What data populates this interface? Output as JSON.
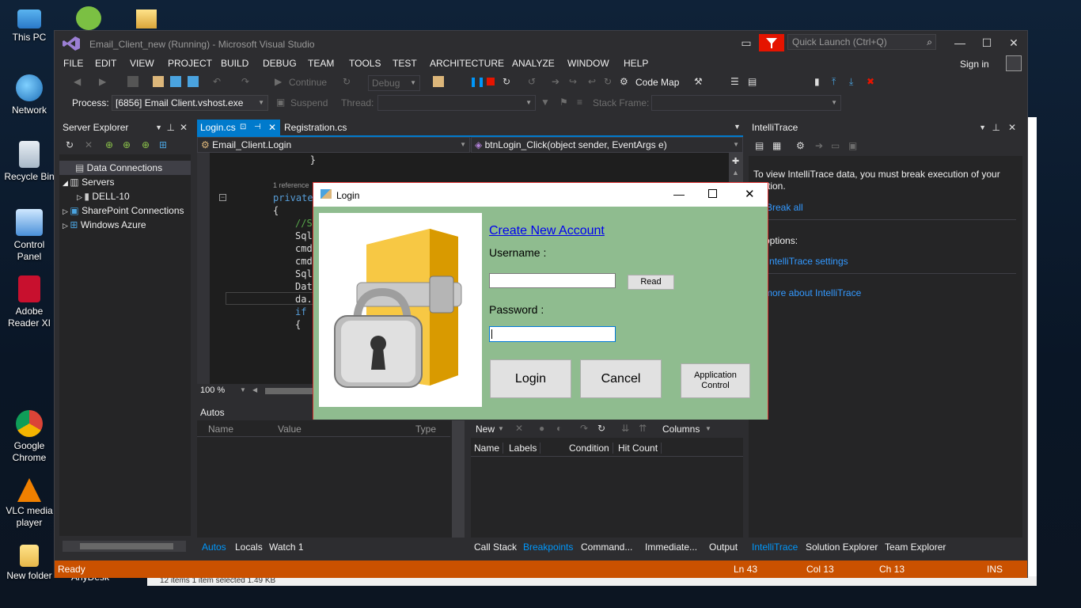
{
  "desktop": {
    "icons": [
      {
        "label": "This PC"
      },
      {
        "label": "Network"
      },
      {
        "label": "Recycle Bin"
      },
      {
        "label": "Control Panel"
      },
      {
        "label": "Adobe Reader XI"
      },
      {
        "label": "Google Chrome"
      },
      {
        "label": "VLC media player"
      },
      {
        "label": "New folder"
      }
    ],
    "anydesk_label": "AnyDesk",
    "bg_status": "12 items     1 item selected  1.49 KB"
  },
  "vs": {
    "title": "Email_Client_new (Running) - Microsoft Visual Studio",
    "quick_launch_placeholder": "Quick Launch (Ctrl+Q)",
    "menu": [
      "FILE",
      "EDIT",
      "VIEW",
      "PROJECT",
      "BUILD",
      "DEBUG",
      "TEAM",
      "TOOLS",
      "TEST",
      "ARCHITECTURE",
      "ANALYZE",
      "WINDOW",
      "HELP"
    ],
    "signin": "Sign in",
    "toolbar": {
      "continue": "Continue",
      "config": "Debug",
      "code_map": "Code Map",
      "process_label": "Process:",
      "process_value": "[6856] Email Client.vshost.exe",
      "suspend": "Suspend",
      "thread_label": "Thread:",
      "stack_frame_label": "Stack Frame:"
    },
    "server_explorer": {
      "title": "Server Explorer",
      "items": [
        {
          "label": "Data Connections"
        },
        {
          "label": "Servers"
        },
        {
          "label": "DELL-10"
        },
        {
          "label": "SharePoint Connections"
        },
        {
          "label": "Windows Azure"
        }
      ]
    },
    "tabs": {
      "active": "Login.cs",
      "other": "Registration.cs",
      "nav_class": "Email_Client.Login",
      "nav_member": "btnLogin_Click(object sender, EventArgs e)"
    },
    "code": {
      "line0": "            }",
      "refs": "1 reference",
      "line1": "private",
      "line2": "{",
      "line3": "//Se",
      "line4": "SqlC",
      "line5": "cmdS",
      "line6": "cmdS",
      "line7": "SqlD",
      "line8": "Data",
      "line9": "da.F",
      "line10": "if (",
      "line11": "{",
      "zoom": "100 %"
    },
    "autos": {
      "title": "Autos",
      "cols": [
        "Name",
        "Value",
        "Type"
      ],
      "tabs": [
        "Autos",
        "Locals",
        "Watch 1"
      ]
    },
    "breakpoints": {
      "toolbar_new": "New",
      "toolbar_columns": "Columns",
      "cols": [
        "Name",
        "Labels",
        "Condition",
        "Hit Count"
      ],
      "tabs": [
        "Call Stack",
        "Breakpoints",
        "Command...",
        "Immediate...",
        "Output"
      ]
    },
    "intellitrace": {
      "title": "IntelliTrace",
      "msg1": "To view IntelliTrace data, you must break execution of your",
      "msg2": "lication.",
      "break_all": "Break all",
      "more": "re options:",
      "settings": "en IntelliTrace settings",
      "learn": "rn more about IntelliTrace",
      "tabs": [
        "IntelliTrace",
        "Solution Explorer",
        "Team Explorer"
      ]
    },
    "status": {
      "ready": "Ready",
      "ln": "Ln 43",
      "col": "Col 13",
      "ch": "Ch 13",
      "ins": "INS"
    }
  },
  "login": {
    "title": "Login",
    "create_account": "Create New Account",
    "username_label": "Username :",
    "password_label": "Password :",
    "read_button": "Read",
    "login_button": "Login",
    "cancel_button": "Cancel",
    "app_control_line1": "Application",
    "app_control_line2": "Control"
  },
  "colors": {
    "vs_bg": "#2d2d30",
    "accent": "#007acc",
    "status_bar": "#ca5100",
    "login_body": "#8fbc8f"
  }
}
